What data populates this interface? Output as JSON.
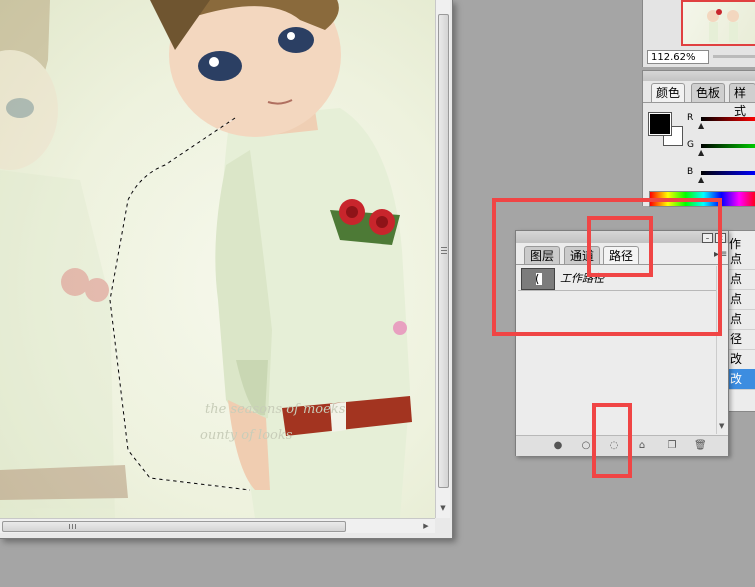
{
  "navigator": {
    "zoom": "112.62%"
  },
  "color_panel": {
    "tabs": [
      "颜色",
      "色板",
      "样式"
    ],
    "active_tab": "颜色",
    "channels": [
      "R",
      "G",
      "B"
    ],
    "foreground_color": "#000000",
    "background_color": "#ffffff"
  },
  "paths_panel": {
    "tabs": [
      "图层",
      "通道",
      "路径"
    ],
    "active_tab": "路径",
    "items": [
      {
        "name": "工作路径"
      }
    ]
  },
  "history_panel": {
    "tab": "作",
    "items": [
      "点",
      "点",
      "点",
      "点",
      "径",
      "改",
      "改"
    ],
    "selected_index": 6
  },
  "canvas": {
    "watermark": [
      "the seasons of moeks",
      "ounty of looks"
    ]
  },
  "colors": {
    "highlight": "#f04545",
    "selection_blue": "#3d8de0"
  }
}
